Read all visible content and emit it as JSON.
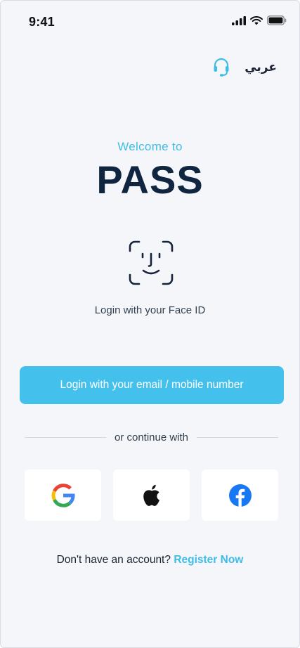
{
  "status_bar": {
    "time": "9:41",
    "icons": [
      "signal-icon",
      "wifi-icon",
      "battery-icon"
    ]
  },
  "header": {
    "support_icon": "headset-icon",
    "language_label": "عربي"
  },
  "welcome": {
    "greeting": "Welcome to",
    "app_name": "PASS"
  },
  "face_id": {
    "icon": "face-id-icon",
    "label": "Login with your Face ID"
  },
  "primary_action": {
    "label": "Login with your email / mobile number"
  },
  "divider": {
    "label": "or continue with"
  },
  "social": {
    "providers": [
      "google-icon",
      "apple-icon",
      "facebook-icon"
    ]
  },
  "register": {
    "prompt": "Don't have an account?",
    "link_label": "Register Now"
  },
  "colors": {
    "accent": "#44c0ec",
    "title": "#0f2540",
    "background": "#f4f6f9",
    "facebook": "#1877f2"
  }
}
